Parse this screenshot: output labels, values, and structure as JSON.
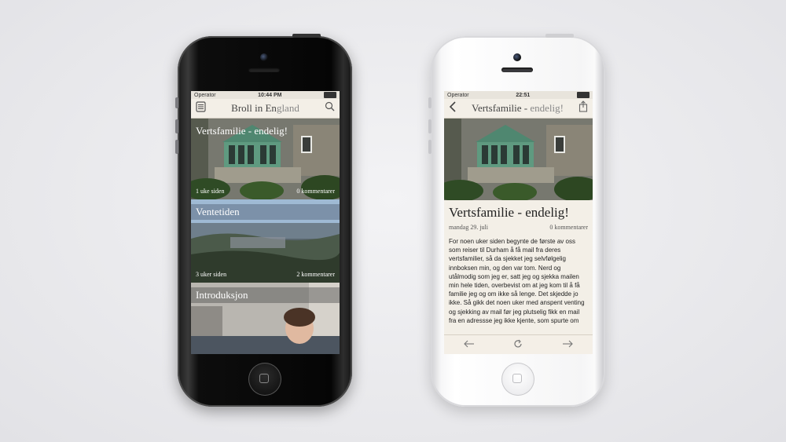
{
  "left_phone": {
    "status": {
      "carrier": "Operator",
      "time": "10:44 PM"
    },
    "nav": {
      "title_main": "Broll in En",
      "title_rest": "gland"
    },
    "posts": [
      {
        "title": "Vertsfamilie - endelig!",
        "age": "1 uke siden",
        "comments": "0 kommentarer"
      },
      {
        "title": "Ventetiden",
        "age": "3 uker siden",
        "comments": "2 kommentarer"
      },
      {
        "title": "Introduksjon"
      }
    ]
  },
  "right_phone": {
    "status": {
      "carrier": "Operator",
      "time": "22:51"
    },
    "nav": {
      "title_main": "Vertsfamilie - ",
      "title_rest": "endelig!"
    },
    "article": {
      "title": "Vertsfamilie - endelig!",
      "date": "mandag 29. juli",
      "comments": "0 kommentarer",
      "body": "For noen uker siden begynte de første av oss som reiser til Durham å få mail fra deres vertsfamilier, så da sjekket jeg selvfølgelig innboksen min, og den var tom. Nerd og utålmodig som jeg er, satt jeg og sjekka mailen min hele tiden, overbevist om at jeg kom til å få familie jeg og om ikke så lenge. Det skjedde jo ikke. Så gikk det noen uker med anspent venting og sjekking av mail før jeg plutselig fikk en mail fra en adressse jeg ikke kjente, som spurte om"
    }
  },
  "icons": {
    "menu": "menu-icon",
    "search": "search-icon",
    "back": "back-icon",
    "share": "share-icon",
    "prev": "arrow-left-icon",
    "refresh": "refresh-icon",
    "next": "arrow-right-icon"
  }
}
